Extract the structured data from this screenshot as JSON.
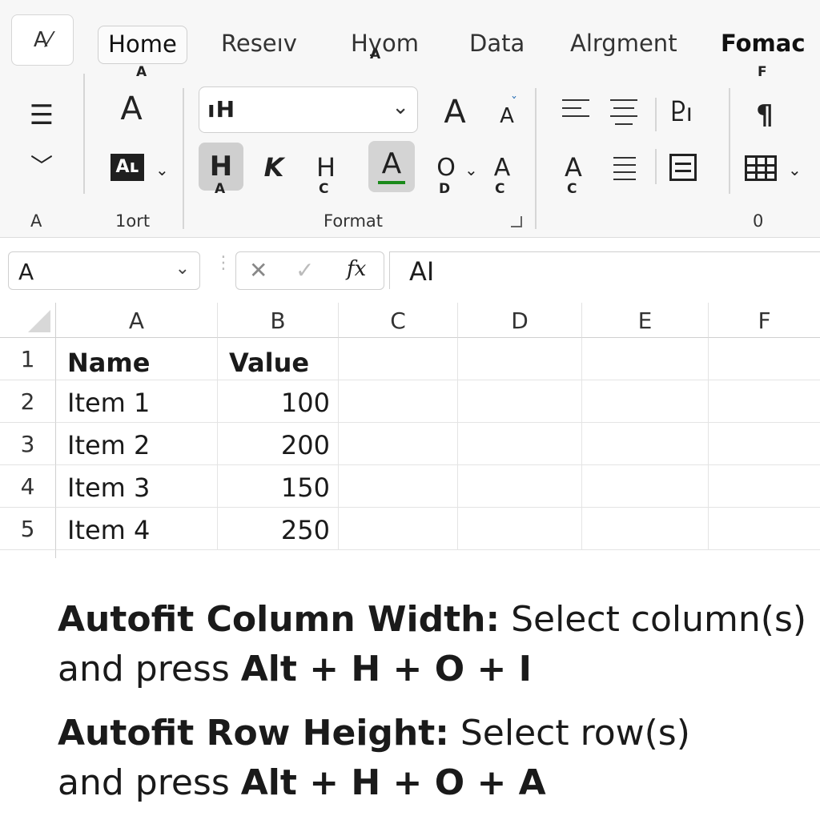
{
  "ribbon": {
    "app_icon_text": "A⁄",
    "tabs": [
      {
        "label": "Home",
        "keytip": "A"
      },
      {
        "label": "Reseıv"
      },
      {
        "label": "Hyom",
        "keytip": "A"
      },
      {
        "label": "Data"
      },
      {
        "label": "Alrgment"
      },
      {
        "label": "Fomac",
        "keytip": "F"
      }
    ],
    "font_name": "ıH",
    "font_size_up": "A",
    "font_size_down": "A",
    "font_color_label": "A",
    "bold_label": "H",
    "bold_keytip": "A",
    "italic_label": "K",
    "underline_label": "H",
    "underline_keytip": "C",
    "highlight_label": "A",
    "border_label": "O",
    "border_keytip": "D",
    "strike_label": "A",
    "strike_keytip": "C",
    "align_keytip": "C",
    "left_col_glyph": "A",
    "style_glyph": "Aʟ",
    "pilcrow": "¶",
    "para_glyph": "Ⴒı",
    "group_labels": {
      "first": "A",
      "second": "1ort",
      "format": "Format",
      "last": "0"
    }
  },
  "formula_bar": {
    "name_box": "A",
    "cancel_icon": "✕",
    "enter_icon": "✓",
    "fx": "fx",
    "content": "AI"
  },
  "sheet": {
    "columns": [
      "A",
      "B",
      "C",
      "D",
      "E",
      "F"
    ],
    "rows": [
      "1",
      "2",
      "3",
      "4",
      "5"
    ],
    "header": {
      "name": "Name",
      "value": "Value"
    },
    "items": [
      {
        "name": "Item 1",
        "value": "100"
      },
      {
        "name": "Item 2",
        "value": "200"
      },
      {
        "name": "Item 3",
        "value": "150"
      },
      {
        "name": "Item 4",
        "value": "250"
      }
    ]
  },
  "tips": {
    "col_title": "Autofit Column Width:",
    "col_text1": " Select column(s)",
    "col_text2": "and press ",
    "col_keys": "Alt + H + O + I",
    "row_title": "Autofit Row Height:",
    "row_text1": " Select row(s)",
    "row_text2": "and press ",
    "row_keys": "Alt + H + O + A"
  },
  "colors": {
    "font_color_bar": "#1a8a1a",
    "accent": "#1f1f1f"
  }
}
